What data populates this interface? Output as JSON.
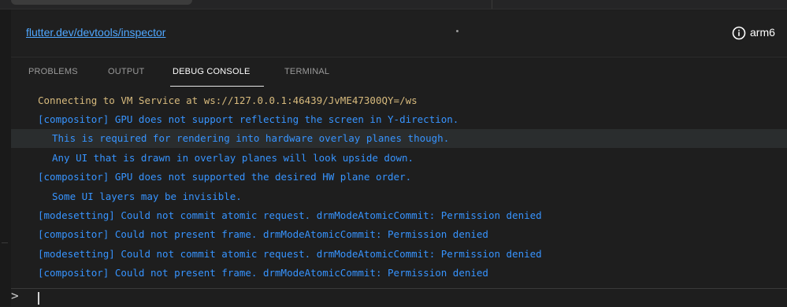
{
  "notification": {
    "link_text": "flutter.dev/devtools/inspector",
    "device_label": "arm6"
  },
  "panel": {
    "tabs": [
      {
        "label": "PROBLEMS",
        "active": false
      },
      {
        "label": "OUTPUT",
        "active": false
      },
      {
        "label": "DEBUG CONSOLE",
        "active": true
      },
      {
        "label": "TERMINAL",
        "active": false
      }
    ]
  },
  "console": {
    "lines": [
      {
        "text": "Connecting to VM Service at ws://127.0.0.1:46439/JvME47300QY=/ws",
        "color": "#d7ba7d",
        "indent": 1,
        "highlight": false
      },
      {
        "text": "[compositor] GPU does not support reflecting the screen in Y-direction.",
        "color": "#3794ff",
        "indent": 0,
        "highlight": false
      },
      {
        "text": "This is required for rendering into hardware overlay planes though.",
        "color": "#3794ff",
        "indent": 2,
        "highlight": true
      },
      {
        "text": "Any UI that is drawn in overlay planes will look upside down.",
        "color": "#3794ff",
        "indent": 2,
        "highlight": false
      },
      {
        "text": "[compositor] GPU does not supported the desired HW plane order.",
        "color": "#3794ff",
        "indent": 0,
        "highlight": false
      },
      {
        "text": "Some UI layers may be invisible.",
        "color": "#3794ff",
        "indent": 2,
        "highlight": false
      },
      {
        "text": "[modesetting] Could not commit atomic request. drmModeAtomicCommit: Permission denied",
        "color": "#3794ff",
        "indent": 0,
        "highlight": false
      },
      {
        "text": "[compositor] Could not present frame. drmModeAtomicCommit: Permission denied",
        "color": "#3794ff",
        "indent": 0,
        "highlight": false
      },
      {
        "text": "[modesetting] Could not commit atomic request. drmModeAtomicCommit: Permission denied",
        "color": "#3794ff",
        "indent": 0,
        "highlight": false
      },
      {
        "text": "[compositor] Could not present frame. drmModeAtomicCommit: Permission denied",
        "color": "#3794ff",
        "indent": 0,
        "highlight": false
      }
    ]
  },
  "prompt": {
    "chevron": ">"
  },
  "icons": {
    "info": "info-circle-icon"
  }
}
